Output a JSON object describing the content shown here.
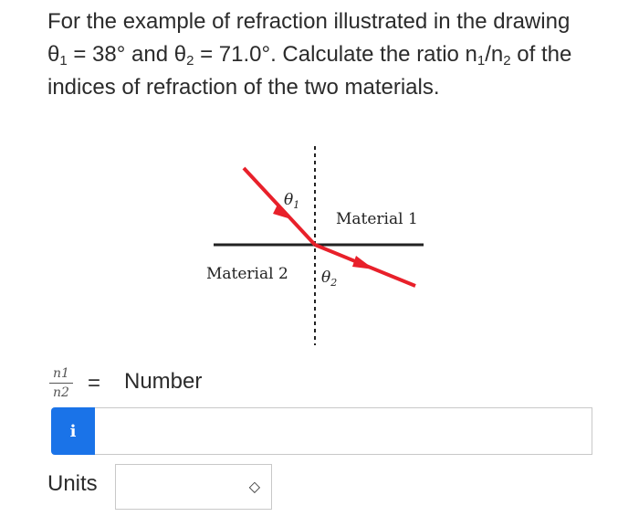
{
  "question": {
    "p1": "For the example of refraction illustrated in the drawing ",
    "theta": "θ",
    "sub1": "1",
    "p2": " = 38° and ",
    "sub2": "2",
    "p3": " = 71.0°. Calculate the ratio ",
    "n": "n",
    "slash": "/",
    "p4": " of the indices of refraction of the two materials."
  },
  "diagram": {
    "theta1_label": "θ",
    "theta1_sub": "1",
    "theta2_label": "θ",
    "theta2_sub": "2",
    "material1": "Material 1",
    "material2": "Material 2",
    "ray_color": "#e8202a"
  },
  "answer": {
    "frac_num": "n1",
    "frac_den": "n2",
    "equals": "=",
    "number_label": "Number",
    "info_icon_glyph": "i",
    "number_value": ""
  },
  "units": {
    "label": "Units",
    "selected": "",
    "chevron": "◇"
  }
}
